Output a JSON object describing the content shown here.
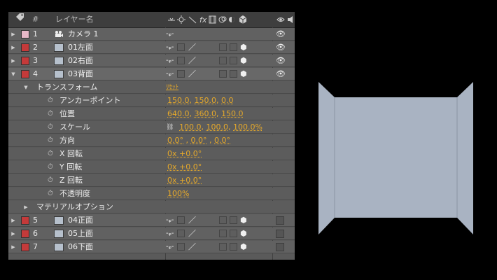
{
  "header": {
    "tag_icon": "tag-icon",
    "num_label": "#",
    "name_label": "レイヤー名",
    "switch_icons": [
      "shy-icon",
      "collapse-icon",
      "quality-icon",
      "fx-icon",
      "frame-blend-icon",
      "motion-blur-icon",
      "adjustment-icon",
      "3d-layer-icon"
    ],
    "fx_label": "fx",
    "right_icons": [
      "eye-icon",
      "audio-icon"
    ]
  },
  "layers": [
    {
      "num": "1",
      "name": "カメラ 1",
      "label_color": "#e7b8c8",
      "type": "camera",
      "expanded": false
    },
    {
      "num": "2",
      "name": "01左面",
      "label_color": "#c43a3a",
      "type": "solid",
      "expanded": false
    },
    {
      "num": "3",
      "name": "02右面",
      "label_color": "#c43a3a",
      "type": "solid",
      "expanded": false
    },
    {
      "num": "4",
      "name": "03背面",
      "label_color": "#c43a3a",
      "type": "solid",
      "expanded": true
    }
  ],
  "transform": {
    "group_label": "トランスフォーム",
    "reset_label": "ﾘｾｯﾄ",
    "properties": [
      {
        "name": "アンカーポイント",
        "values": [
          "150.0",
          "150.0",
          "0.0"
        ],
        "sep": ", "
      },
      {
        "name": "位置",
        "values": [
          "640.0",
          "360.0",
          "150.0"
        ],
        "sep": ", "
      },
      {
        "name": "スケール",
        "values": [
          "100.0",
          "100.0",
          "100.0%"
        ],
        "sep": ", ",
        "link": true
      },
      {
        "name": "方向",
        "values": [
          "0.0°",
          "0.0°",
          "0.0°"
        ],
        "sep": " , "
      },
      {
        "name": "X 回転",
        "values": [
          "0x +0.0°"
        ]
      },
      {
        "name": "Y 回転",
        "values": [
          "0x +0.0°"
        ]
      },
      {
        "name": "Z 回転",
        "values": [
          "0x +0.0°"
        ]
      },
      {
        "name": "不透明度",
        "values": [
          "100%"
        ]
      }
    ]
  },
  "material_options_label": "マテリアルオプション",
  "layers_after": [
    {
      "num": "5",
      "name": "04正面",
      "label_color": "#c43a3a",
      "type": "solid"
    },
    {
      "num": "6",
      "name": "05上面",
      "label_color": "#c43a3a",
      "type": "solid"
    },
    {
      "num": "7",
      "name": "06下面",
      "label_color": "#c43a3a",
      "type": "solid"
    }
  ],
  "viewer": {
    "face_color": "#a9b3c2",
    "edge_color": "#8c96a4",
    "background": "#000000"
  }
}
